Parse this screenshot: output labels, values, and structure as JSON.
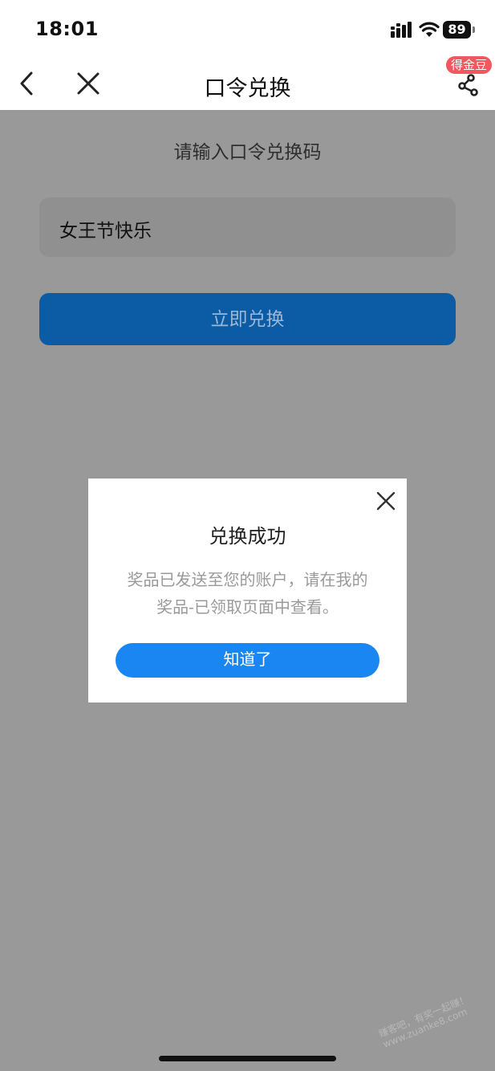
{
  "status_bar": {
    "time": "18:01",
    "battery": "89"
  },
  "nav": {
    "title": "口令兑换",
    "badge": "得金豆"
  },
  "page": {
    "prompt": "请输入口令兑换码",
    "code_value": "女王节快乐",
    "redeem_label": "立即兑换"
  },
  "dialog": {
    "title": "兑换成功",
    "message_line1": "奖品已发送至您的账户，请在我的",
    "message_line2": "奖品-已领取页面中查看。",
    "ok_label": "知道了"
  },
  "watermark": {
    "line1": "赚客吧，有奖一起赚！",
    "line2": "www.zuanke8.com"
  },
  "colors": {
    "overlay": "#999999",
    "primary": "#1a86f2",
    "badge": "#f0575f"
  },
  "icons": [
    "signal-icon",
    "wifi-icon",
    "battery-icon",
    "back-icon",
    "close-icon",
    "share-icon",
    "dialog-close-icon"
  ]
}
